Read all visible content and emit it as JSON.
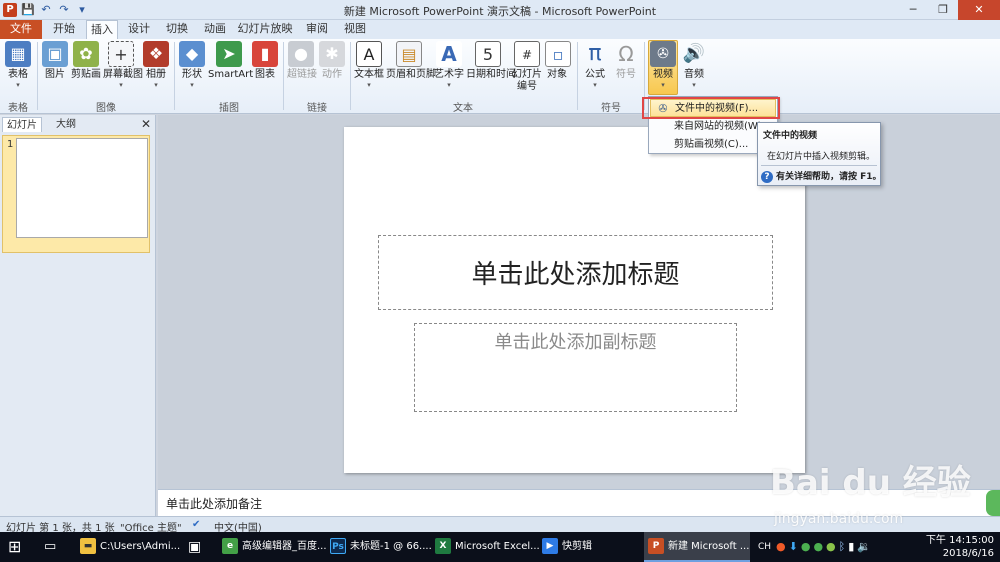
{
  "window": {
    "title": "新建 Microsoft PowerPoint 演示文稿 - Microsoft PowerPoint",
    "app_letter": "P",
    "minimize": "─",
    "maximize": "❐",
    "close": "✕"
  },
  "qat": [
    "💾",
    "↶",
    "↷",
    "▾"
  ],
  "tabs": [
    "文件",
    "开始",
    "插入",
    "设计",
    "切换",
    "动画",
    "幻灯片放映",
    "审阅",
    "视图"
  ],
  "ribbon": {
    "buttons": {
      "table": "表格",
      "picture": "图片",
      "clipart": "剪贴画",
      "screenshot": "屏幕截图",
      "album": "相册",
      "shapes": "形状",
      "smartart": "SmartArt",
      "chart": "图表",
      "hyperlink": "超链接",
      "action": "动作",
      "textbox": "文本框",
      "header_footer": "页眉和页脚",
      "wordart": "艺术字",
      "datetime": "日期和时间",
      "slide_number_1": "幻灯片",
      "slide_number_2": "编号",
      "object": "对象",
      "equation": "公式",
      "symbol": "符号",
      "video": "视频",
      "audio": "音频"
    },
    "groups": {
      "tables": "表格",
      "images": "图像",
      "illustrations": "插图",
      "links": "链接",
      "text": "文本",
      "symbols": "符号"
    }
  },
  "video_menu": {
    "items": [
      "文件中的视频(F)...",
      "来自网站的视频(W)...",
      "剪贴画视频(C)..."
    ]
  },
  "tooltip": {
    "title": "文件中的视频",
    "description": "在幻灯片中插入视频剪辑。",
    "help": "有关详细帮助，请按 F1。"
  },
  "left_pane": {
    "tabs": [
      "幻灯片",
      "大纲"
    ],
    "close": "✕",
    "slide_number": "1"
  },
  "slide": {
    "title_placeholder": "单击此处添加标题",
    "subtitle_placeholder": "单击此处添加副标题"
  },
  "notes_placeholder": "单击此处添加备注",
  "status": {
    "slide_info": "幻灯片 第 1 张，共 1 张",
    "theme": "\"Office 主题\"",
    "language": "中文(中国)"
  },
  "taskbar": {
    "items": [
      "C:\\Users\\Admi...",
      "高级编辑器_百度...",
      "未标题-1 @ 66....",
      "Microsoft Excel...",
      "快剪辑",
      "新建 Microsoft ..."
    ],
    "ime": "CH",
    "time_line1": "下午 14:15:00",
    "date": "2018/6/16"
  },
  "watermark": {
    "text": "Bai du 经验",
    "sub": "jingyan.baidu.com"
  },
  "colors": {
    "file_tab": "#c84f24",
    "highlight": "#f8c84f",
    "red_box": "#e04646",
    "taskbar": "#0b0f1a"
  }
}
